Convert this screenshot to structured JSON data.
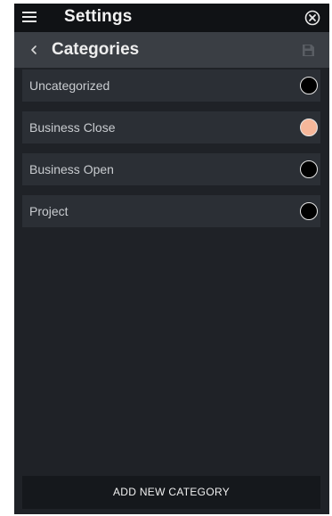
{
  "topbar": {
    "title": "Settings",
    "menu_icon": "hamburger-menu-icon",
    "close_icon": "close-circle-icon"
  },
  "subbar": {
    "title": "Categories",
    "back_icon": "chevron-left-icon",
    "save_icon": "floppy-disk-icon"
  },
  "categories": [
    {
      "label": "Uncategorized",
      "color": "#000000"
    },
    {
      "label": "Business Close",
      "color": "#f6b79a"
    },
    {
      "label": "Business Open",
      "color": "#000000"
    },
    {
      "label": "Project",
      "color": "#000000"
    }
  ],
  "add_button": {
    "label": "ADD NEW CATEGORY"
  },
  "colors": {
    "topbar_bg": "#101215",
    "subbar_bg": "#3a3e44",
    "panel_bg": "#1f2227",
    "row_bg": "#2b2f35",
    "button_bg": "#15181c"
  }
}
